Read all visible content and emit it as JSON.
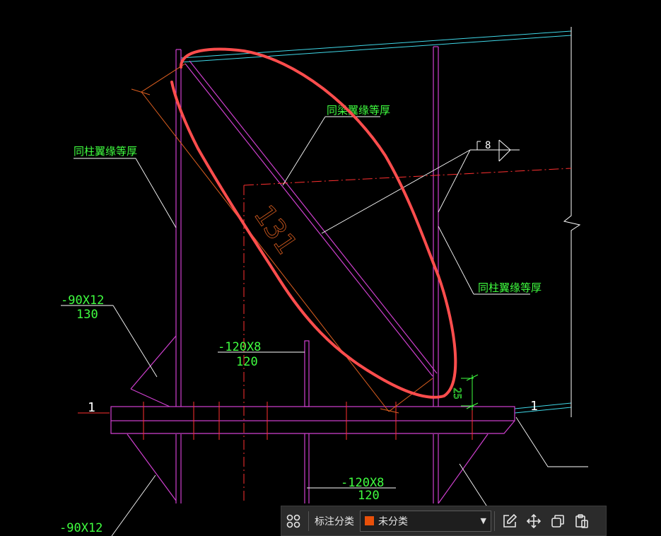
{
  "drawing": {
    "labels": {
      "beam_flange_equal": "同梁翼缘等厚",
      "column_flange_equal_left": "同柱翼缘等厚",
      "column_flange_equal_right": "同柱翼缘等厚",
      "weld_symbol": "8",
      "dimension_131": "131",
      "stiffener_top_left_size": "-90X12",
      "stiffener_top_left_len": "130",
      "plate_mid_size": "-120X8",
      "plate_mid_len": "120",
      "plate_bottom_size": "-120X8",
      "plate_bottom_len": "120",
      "stiffener_bottom_left_size": "-90X12",
      "section_mark_left": "1",
      "section_mark_right": "1",
      "dim_25": "25"
    },
    "colors": {
      "magenta": "#d040d0",
      "cyan": "#40d8e8",
      "green": "#40ff40",
      "red": "#ff3030",
      "orange": "#e06020",
      "white": "#ffffff",
      "yellow": "#e8e040",
      "annotation_red": "#ff4d4d"
    }
  },
  "toolbar": {
    "category_label": "标注分类",
    "category_value": "未分类",
    "category_swatch": "#e8500a",
    "icons": [
      "grid-icon",
      "edit-icon",
      "move-icon",
      "copy-icon",
      "paste-icon"
    ]
  }
}
